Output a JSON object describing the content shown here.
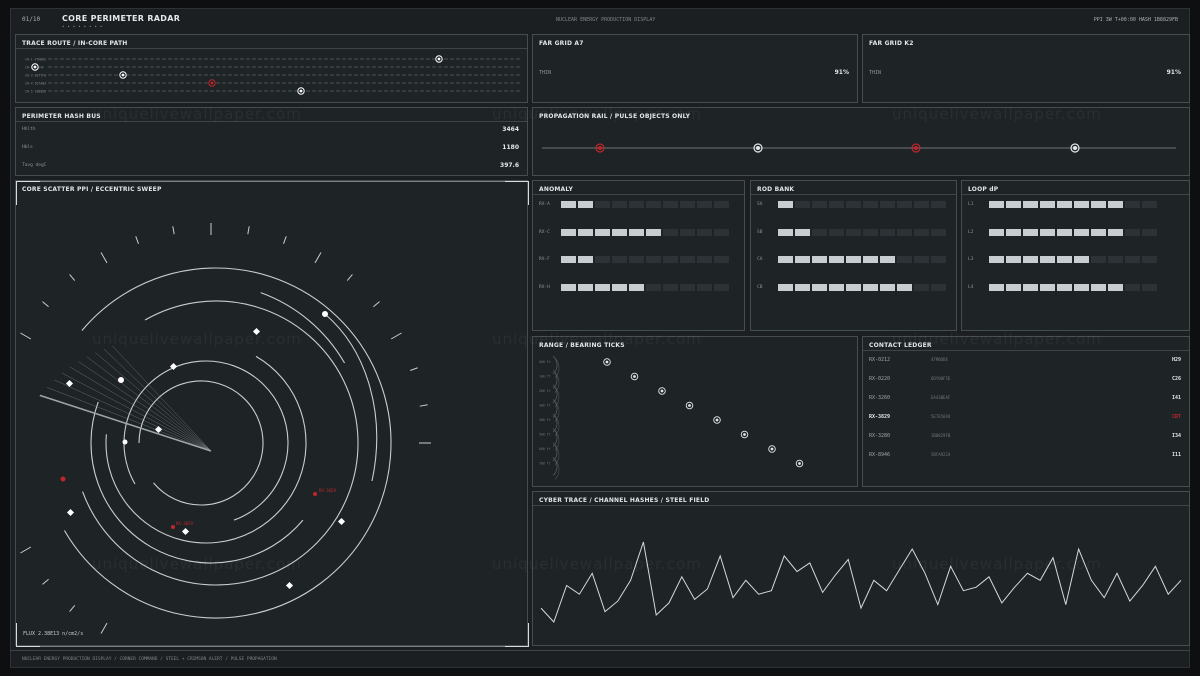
{
  "header": {
    "page": "01/10",
    "title": "CORE PERIMETER RADAR",
    "center": "NUCLEAR ENERGY PRODUCTION DISPLAY",
    "right": "PPI 3W T+00:00  HASH 1B8829FB"
  },
  "trace_route": {
    "title": "TRACE ROUTE  /  IN-CORE PATH",
    "lanes": [
      "CH-1 4THBAE",
      "CH-2 23/4F",
      "CH-3 E0TTFB",
      "CH-4 5E7ABA",
      "CH-5 1B88DB"
    ]
  },
  "far_grid_a7": {
    "title": "FAR GRID  A7",
    "label": "THIN",
    "value": "91%"
  },
  "far_grid_k2": {
    "title": "FAR GRID  K2",
    "label": "THIN",
    "value": "91%"
  },
  "hash_bus": {
    "title": "PERIMETER HASH BUS",
    "rows": [
      {
        "label": "Hhlth",
        "value": "3464"
      },
      {
        "label": "Hbls",
        "value": "1180"
      },
      {
        "label": "Tavg degC",
        "value": "397.6"
      }
    ]
  },
  "propagation": {
    "title": "PROPAGATION RAIL  /  PULSE OBJECTS ONLY"
  },
  "ppi": {
    "title": "CORE SCATTER PPI  /  ECCENTRIC SWEEP",
    "flux": "FLUX 2.38E13 n/cm2/s",
    "contact_labels": [
      "RX-3829",
      "RX-3829"
    ]
  },
  "anomaly": {
    "title": "ANOMALY",
    "rows": [
      {
        "label": "RX-A",
        "level": 2
      },
      {
        "label": "RX-C",
        "level": 6
      },
      {
        "label": "RX-F",
        "level": 2
      },
      {
        "label": "RX-H",
        "level": 5
      }
    ],
    "segments": 10
  },
  "rod_bank": {
    "title": "ROD BANK",
    "rows": [
      {
        "label": "SA",
        "level": 1
      },
      {
        "label": "SB",
        "level": 2
      },
      {
        "label": "CA",
        "level": 7
      },
      {
        "label": "CB",
        "level": 8
      }
    ],
    "segments": 10
  },
  "loop_dp": {
    "title": "LOOP dP",
    "rows": [
      {
        "label": "L1",
        "level": 8
      },
      {
        "label": "L2",
        "level": 8
      },
      {
        "label": "L3",
        "level": 6
      },
      {
        "label": "L4",
        "level": 8
      }
    ],
    "segments": 10
  },
  "bearing": {
    "title": "RANGE / BEARING TICKS",
    "ticks": [
      "000 ft",
      "100 ft",
      "200 ft",
      "300 ft",
      "400 ft",
      "500 ft",
      "600 ft",
      "700 ft"
    ]
  },
  "contact_ledger": {
    "title": "CONTACT LEDGER",
    "rows": [
      {
        "id": "RX-0212",
        "hash": "4TM0DDE",
        "code": "H29",
        "alert": false
      },
      {
        "id": "RX-0220",
        "hash": "6DY08F5E",
        "code": "C26",
        "alert": false
      },
      {
        "id": "RX-3260",
        "hash": "EA43BEAF",
        "code": "I41",
        "alert": false
      },
      {
        "id": "RX-3829",
        "hash": "5E7E5694",
        "code": "CRT",
        "alert": true
      },
      {
        "id": "RX-3280",
        "hash": "1B8829FB",
        "code": "I34",
        "alert": false
      },
      {
        "id": "RX-8946",
        "hash": "5BFA9224",
        "code": "I11",
        "alert": false
      }
    ]
  },
  "cyber_trace": {
    "title": "CYBER TRACE  /  CHANNEL HASHES  /  STEEL FIELD",
    "values": [
      42,
      34,
      55,
      50,
      62,
      40,
      46,
      58,
      80,
      38,
      45,
      60,
      47,
      53,
      72,
      48,
      58,
      50,
      52,
      72,
      63,
      68,
      51,
      61,
      70,
      42,
      58,
      52,
      64,
      76,
      62,
      44,
      66,
      52,
      54,
      60,
      45,
      54,
      62,
      58,
      71,
      44,
      76,
      58,
      48,
      62,
      46,
      55,
      66,
      50,
      58
    ]
  },
  "footer": "NUCLEAR ENERGY PRODUCTION DISPLAY  /  CORNER COMMAND  /  STEEL + CRIMSON ALERT  /  PULSE PROPAGATION",
  "watermark": "uniquelivewallpaper.com",
  "colors": {
    "accent": "#c0262d",
    "steel": "#c7cdd0",
    "panel": "#1e2325"
  }
}
